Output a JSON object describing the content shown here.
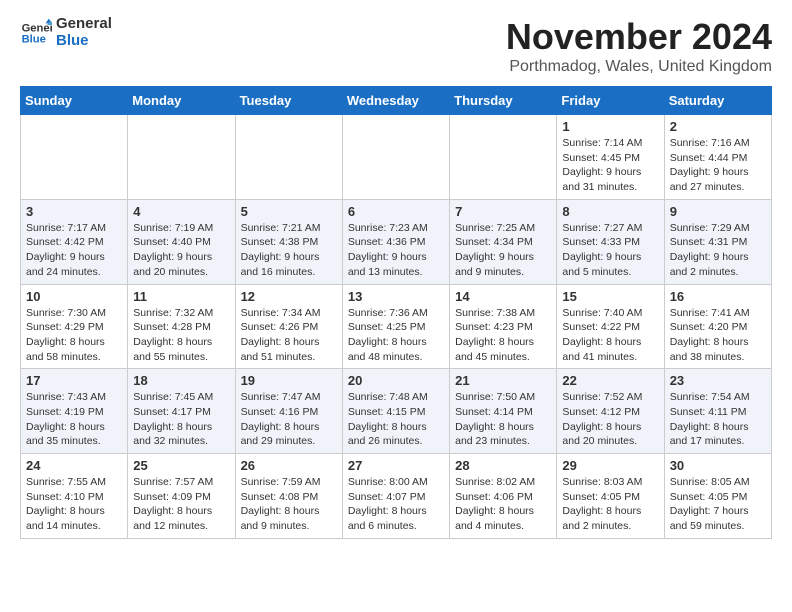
{
  "logo": {
    "line1": "General",
    "line2": "Blue"
  },
  "title": "November 2024",
  "location": "Porthmadog, Wales, United Kingdom",
  "weekdays": [
    "Sunday",
    "Monday",
    "Tuesday",
    "Wednesday",
    "Thursday",
    "Friday",
    "Saturday"
  ],
  "weeks": [
    [
      {
        "day": "",
        "sunrise": "",
        "sunset": "",
        "daylight": ""
      },
      {
        "day": "",
        "sunrise": "",
        "sunset": "",
        "daylight": ""
      },
      {
        "day": "",
        "sunrise": "",
        "sunset": "",
        "daylight": ""
      },
      {
        "day": "",
        "sunrise": "",
        "sunset": "",
        "daylight": ""
      },
      {
        "day": "",
        "sunrise": "",
        "sunset": "",
        "daylight": ""
      },
      {
        "day": "1",
        "sunrise": "Sunrise: 7:14 AM",
        "sunset": "Sunset: 4:45 PM",
        "daylight": "Daylight: 9 hours and 31 minutes."
      },
      {
        "day": "2",
        "sunrise": "Sunrise: 7:16 AM",
        "sunset": "Sunset: 4:44 PM",
        "daylight": "Daylight: 9 hours and 27 minutes."
      }
    ],
    [
      {
        "day": "3",
        "sunrise": "Sunrise: 7:17 AM",
        "sunset": "Sunset: 4:42 PM",
        "daylight": "Daylight: 9 hours and 24 minutes."
      },
      {
        "day": "4",
        "sunrise": "Sunrise: 7:19 AM",
        "sunset": "Sunset: 4:40 PM",
        "daylight": "Daylight: 9 hours and 20 minutes."
      },
      {
        "day": "5",
        "sunrise": "Sunrise: 7:21 AM",
        "sunset": "Sunset: 4:38 PM",
        "daylight": "Daylight: 9 hours and 16 minutes."
      },
      {
        "day": "6",
        "sunrise": "Sunrise: 7:23 AM",
        "sunset": "Sunset: 4:36 PM",
        "daylight": "Daylight: 9 hours and 13 minutes."
      },
      {
        "day": "7",
        "sunrise": "Sunrise: 7:25 AM",
        "sunset": "Sunset: 4:34 PM",
        "daylight": "Daylight: 9 hours and 9 minutes."
      },
      {
        "day": "8",
        "sunrise": "Sunrise: 7:27 AM",
        "sunset": "Sunset: 4:33 PM",
        "daylight": "Daylight: 9 hours and 5 minutes."
      },
      {
        "day": "9",
        "sunrise": "Sunrise: 7:29 AM",
        "sunset": "Sunset: 4:31 PM",
        "daylight": "Daylight: 9 hours and 2 minutes."
      }
    ],
    [
      {
        "day": "10",
        "sunrise": "Sunrise: 7:30 AM",
        "sunset": "Sunset: 4:29 PM",
        "daylight": "Daylight: 8 hours and 58 minutes."
      },
      {
        "day": "11",
        "sunrise": "Sunrise: 7:32 AM",
        "sunset": "Sunset: 4:28 PM",
        "daylight": "Daylight: 8 hours and 55 minutes."
      },
      {
        "day": "12",
        "sunrise": "Sunrise: 7:34 AM",
        "sunset": "Sunset: 4:26 PM",
        "daylight": "Daylight: 8 hours and 51 minutes."
      },
      {
        "day": "13",
        "sunrise": "Sunrise: 7:36 AM",
        "sunset": "Sunset: 4:25 PM",
        "daylight": "Daylight: 8 hours and 48 minutes."
      },
      {
        "day": "14",
        "sunrise": "Sunrise: 7:38 AM",
        "sunset": "Sunset: 4:23 PM",
        "daylight": "Daylight: 8 hours and 45 minutes."
      },
      {
        "day": "15",
        "sunrise": "Sunrise: 7:40 AM",
        "sunset": "Sunset: 4:22 PM",
        "daylight": "Daylight: 8 hours and 41 minutes."
      },
      {
        "day": "16",
        "sunrise": "Sunrise: 7:41 AM",
        "sunset": "Sunset: 4:20 PM",
        "daylight": "Daylight: 8 hours and 38 minutes."
      }
    ],
    [
      {
        "day": "17",
        "sunrise": "Sunrise: 7:43 AM",
        "sunset": "Sunset: 4:19 PM",
        "daylight": "Daylight: 8 hours and 35 minutes."
      },
      {
        "day": "18",
        "sunrise": "Sunrise: 7:45 AM",
        "sunset": "Sunset: 4:17 PM",
        "daylight": "Daylight: 8 hours and 32 minutes."
      },
      {
        "day": "19",
        "sunrise": "Sunrise: 7:47 AM",
        "sunset": "Sunset: 4:16 PM",
        "daylight": "Daylight: 8 hours and 29 minutes."
      },
      {
        "day": "20",
        "sunrise": "Sunrise: 7:48 AM",
        "sunset": "Sunset: 4:15 PM",
        "daylight": "Daylight: 8 hours and 26 minutes."
      },
      {
        "day": "21",
        "sunrise": "Sunrise: 7:50 AM",
        "sunset": "Sunset: 4:14 PM",
        "daylight": "Daylight: 8 hours and 23 minutes."
      },
      {
        "day": "22",
        "sunrise": "Sunrise: 7:52 AM",
        "sunset": "Sunset: 4:12 PM",
        "daylight": "Daylight: 8 hours and 20 minutes."
      },
      {
        "day": "23",
        "sunrise": "Sunrise: 7:54 AM",
        "sunset": "Sunset: 4:11 PM",
        "daylight": "Daylight: 8 hours and 17 minutes."
      }
    ],
    [
      {
        "day": "24",
        "sunrise": "Sunrise: 7:55 AM",
        "sunset": "Sunset: 4:10 PM",
        "daylight": "Daylight: 8 hours and 14 minutes."
      },
      {
        "day": "25",
        "sunrise": "Sunrise: 7:57 AM",
        "sunset": "Sunset: 4:09 PM",
        "daylight": "Daylight: 8 hours and 12 minutes."
      },
      {
        "day": "26",
        "sunrise": "Sunrise: 7:59 AM",
        "sunset": "Sunset: 4:08 PM",
        "daylight": "Daylight: 8 hours and 9 minutes."
      },
      {
        "day": "27",
        "sunrise": "Sunrise: 8:00 AM",
        "sunset": "Sunset: 4:07 PM",
        "daylight": "Daylight: 8 hours and 6 minutes."
      },
      {
        "day": "28",
        "sunrise": "Sunrise: 8:02 AM",
        "sunset": "Sunset: 4:06 PM",
        "daylight": "Daylight: 8 hours and 4 minutes."
      },
      {
        "day": "29",
        "sunrise": "Sunrise: 8:03 AM",
        "sunset": "Sunset: 4:05 PM",
        "daylight": "Daylight: 8 hours and 2 minutes."
      },
      {
        "day": "30",
        "sunrise": "Sunrise: 8:05 AM",
        "sunset": "Sunset: 4:05 PM",
        "daylight": "Daylight: 7 hours and 59 minutes."
      }
    ]
  ]
}
